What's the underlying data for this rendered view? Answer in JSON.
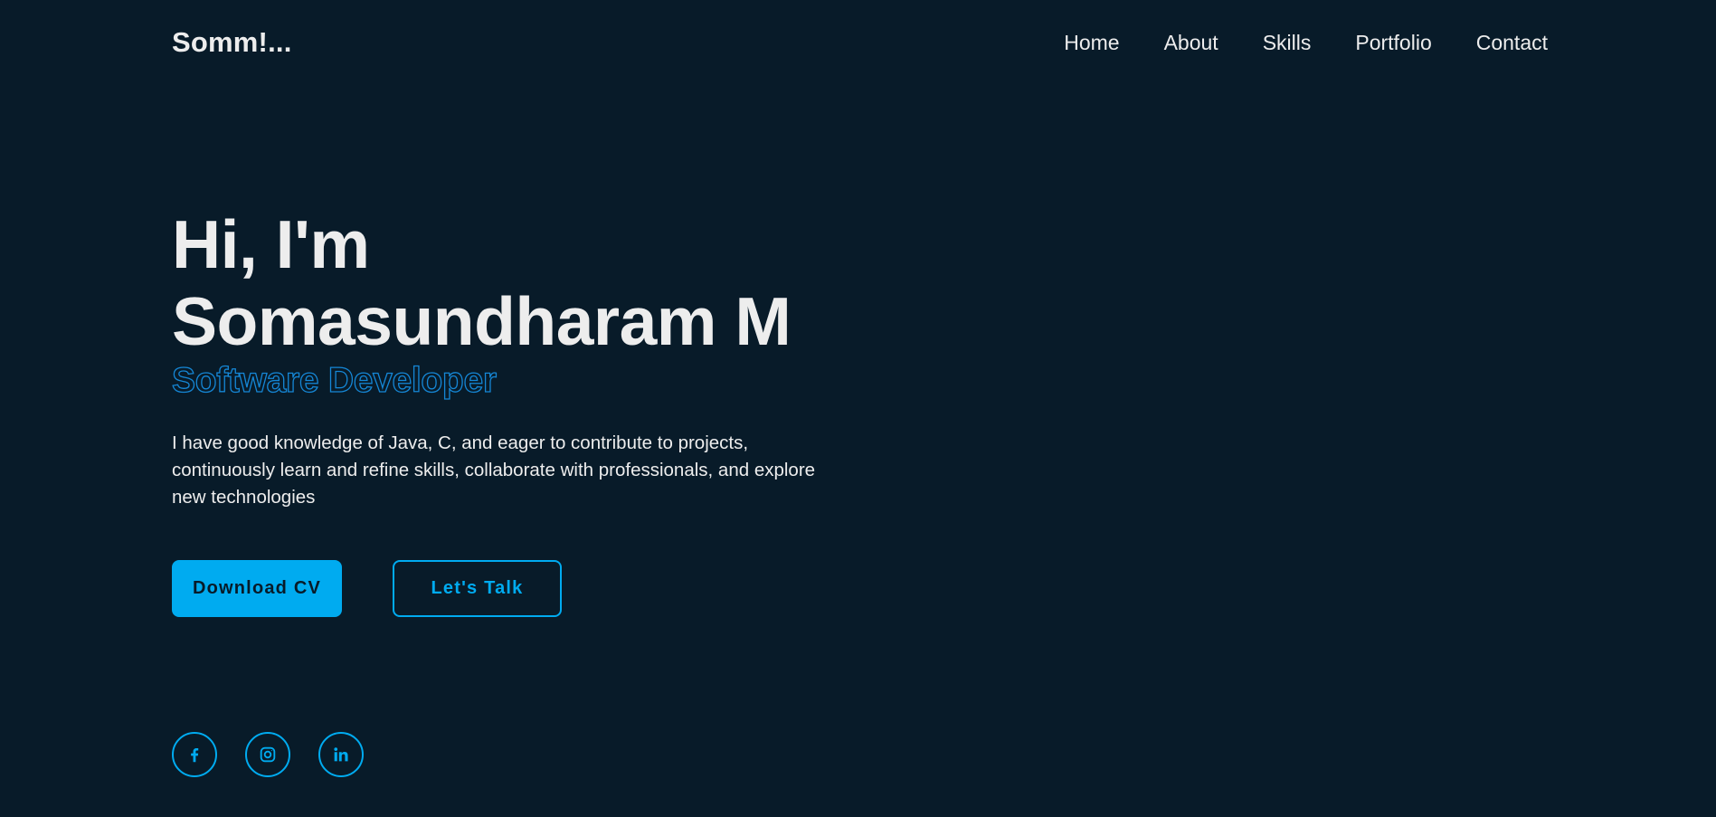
{
  "header": {
    "logo": "Somm!...",
    "nav": [
      {
        "label": "Home"
      },
      {
        "label": "About"
      },
      {
        "label": "Skills"
      },
      {
        "label": "Portfolio"
      },
      {
        "label": "Contact"
      }
    ]
  },
  "hero": {
    "greeting": "Hi, I'm",
    "name": "Somasundharam M",
    "role": "Software Developer",
    "description": "I have good knowledge of Java, C, and eager to contribute to projects, continuously learn and refine skills, collaborate with professionals, and explore new technologies"
  },
  "buttons": {
    "download_cv": "Download CV",
    "lets_talk": "Let's Talk"
  },
  "socials": [
    {
      "icon": "facebook-icon"
    },
    {
      "icon": "instagram-icon"
    },
    {
      "icon": "linkedin-icon"
    }
  ],
  "colors": {
    "background": "#081b29",
    "accent": "#00abf0",
    "text": "#ededed"
  }
}
